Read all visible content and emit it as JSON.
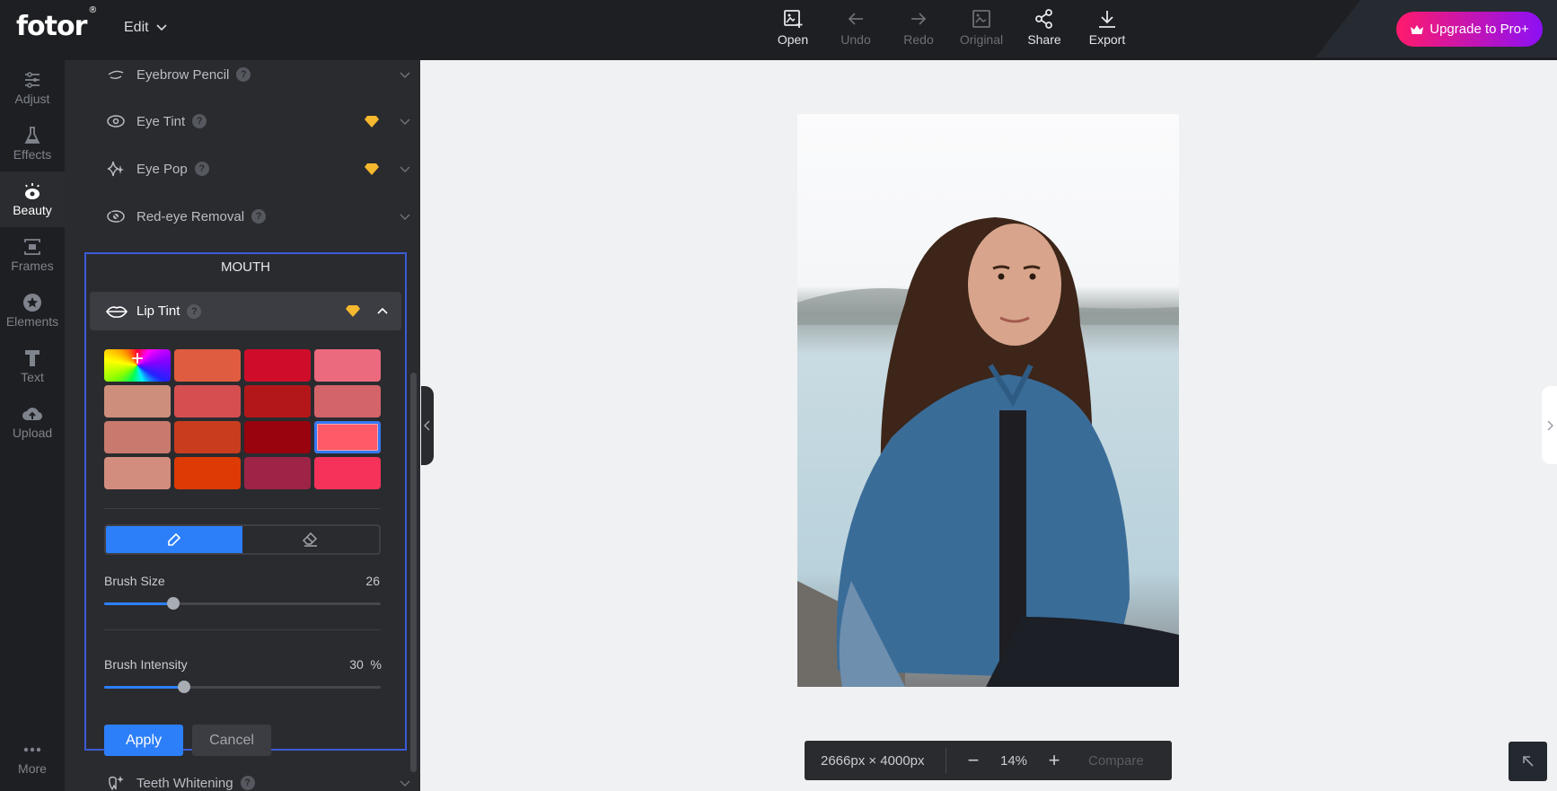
{
  "app": {
    "logo": "fotor",
    "logo_mark": "®",
    "edit_menu": "Edit"
  },
  "toolbar": [
    {
      "label": "Open",
      "icon": "image-add-icon",
      "enabled": true
    },
    {
      "label": "Undo",
      "icon": "arrow-left-icon",
      "enabled": false
    },
    {
      "label": "Redo",
      "icon": "arrow-right-icon",
      "enabled": false
    },
    {
      "label": "Original",
      "icon": "image-icon",
      "enabled": false
    },
    {
      "label": "Share",
      "icon": "share-icon",
      "enabled": true
    },
    {
      "label": "Export",
      "icon": "download-icon",
      "enabled": true
    }
  ],
  "upgrade": {
    "label": "Upgrade to Pro+",
    "icon": "crown-icon"
  },
  "rail": [
    {
      "label": "Adjust",
      "icon": "sliders-icon"
    },
    {
      "label": "Effects",
      "icon": "flask-icon"
    },
    {
      "label": "Beauty",
      "icon": "eye-icon",
      "active": true
    },
    {
      "label": "Frames",
      "icon": "frame-icon"
    },
    {
      "label": "Elements",
      "icon": "star-circle-icon"
    },
    {
      "label": "Text",
      "icon": "text-icon"
    },
    {
      "label": "Upload",
      "icon": "cloud-upload-icon"
    },
    {
      "label": "More",
      "icon": "more-dots-icon"
    }
  ],
  "panel": {
    "features_above": [
      {
        "label": "Eyebrow Pencil",
        "icon": "eyebrow-icon",
        "pro": false
      },
      {
        "label": "Eye Tint",
        "icon": "eye-icon",
        "pro": true
      },
      {
        "label": "Eye Pop",
        "icon": "sparkle-icon",
        "pro": true
      },
      {
        "label": "Red-eye Removal",
        "icon": "red-eye-icon",
        "pro": false
      }
    ],
    "section_title": "MOUTH",
    "active_feature": {
      "label": "Lip Tint",
      "icon": "lips-icon",
      "pro": true,
      "expanded": true
    },
    "swatches": [
      {
        "color": "rainbow",
        "type": "custom-color-picker"
      },
      {
        "color": "#e05c40"
      },
      {
        "color": "#cf0d2a"
      },
      {
        "color": "#eb6a7e"
      },
      {
        "color": "#cd8f7c"
      },
      {
        "color": "#d54f50"
      },
      {
        "color": "#b3171a"
      },
      {
        "color": "#d3646a"
      },
      {
        "color": "#c97a6e"
      },
      {
        "color": "#c93c1e"
      },
      {
        "color": "#98030e"
      },
      {
        "color": "#ff5a67",
        "selected": true
      },
      {
        "color": "#d38d7e"
      },
      {
        "color": "#dd3a06"
      },
      {
        "color": "#9d2446"
      },
      {
        "color": "#f5335a"
      }
    ],
    "mode": {
      "brush_icon": "pencil-icon",
      "eraser_icon": "eraser-icon",
      "active": "brush"
    },
    "brush_size": {
      "label": "Brush Size",
      "value": "26",
      "fraction": 0.25
    },
    "brush_intensity": {
      "label": "Brush Intensity",
      "value": "30",
      "unit": "%",
      "fraction": 0.29
    },
    "apply": "Apply",
    "cancel": "Cancel",
    "features_below": [
      {
        "label": "Teeth Whitening",
        "icon": "tooth-icon",
        "pro": false
      }
    ]
  },
  "canvas": {
    "dimensions": "2666px × 4000px",
    "zoom": "14%",
    "compare": "Compare"
  },
  "colors": {
    "accent": "#2d7ff9",
    "focus_border": "#3a5bd6",
    "gem": "#f5b82e"
  }
}
